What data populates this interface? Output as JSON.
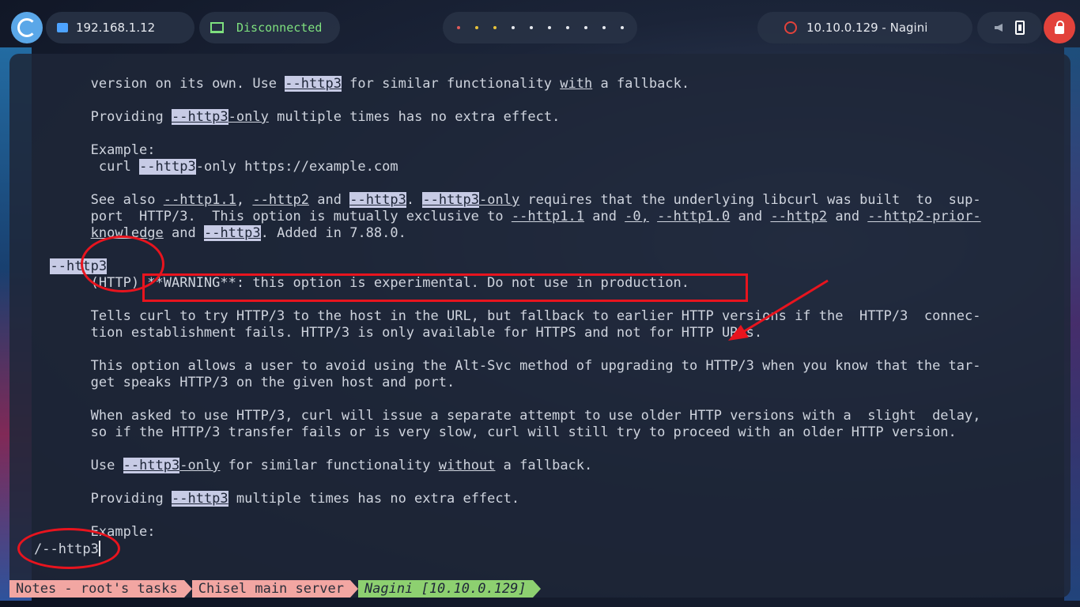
{
  "topbar": {
    "ip": "192.168.1.12",
    "vpn_status": "Disconnected",
    "target": "10.10.0.129 - Nagini",
    "workspace_count": 10,
    "colors": {
      "accent": "#5aa7e8",
      "vpn": "#7ee07e",
      "danger": "#e2423b"
    }
  },
  "terminal": {
    "lines": [
      {
        "segments": [
          {
            "t": "       version on its own. Use "
          },
          {
            "t": "--http3",
            "hl": true,
            "ul": true
          },
          {
            "t": " for similar functionality "
          },
          {
            "t": "with",
            "ul": true
          },
          {
            "t": " a fallback."
          }
        ]
      },
      {
        "segments": [
          {
            "t": ""
          }
        ]
      },
      {
        "segments": [
          {
            "t": "       Providing "
          },
          {
            "t": "--http3",
            "hl": true,
            "ul": true
          },
          {
            "t": "-only",
            "ul": true
          },
          {
            "t": " multiple times has no extra effect."
          }
        ]
      },
      {
        "segments": [
          {
            "t": ""
          }
        ]
      },
      {
        "segments": [
          {
            "t": "       Example:"
          }
        ]
      },
      {
        "segments": [
          {
            "t": "        curl "
          },
          {
            "t": "--http3",
            "hl": true
          },
          {
            "t": "-only https://example.com"
          }
        ]
      },
      {
        "segments": [
          {
            "t": ""
          }
        ]
      },
      {
        "segments": [
          {
            "t": "       See also "
          },
          {
            "t": "--http1.1",
            "ul": true
          },
          {
            "t": ", "
          },
          {
            "t": "--http2",
            "ul": true
          },
          {
            "t": " and "
          },
          {
            "t": "--http3",
            "hl": true,
            "ul": true
          },
          {
            "t": ". "
          },
          {
            "t": "--http3",
            "hl": true,
            "ul": true
          },
          {
            "t": "-only",
            "ul": true
          },
          {
            "t": " requires that the underlying libcurl was built  to  sup-"
          }
        ]
      },
      {
        "segments": [
          {
            "t": "       port  HTTP/3.  This option is mutually exclusive to "
          },
          {
            "t": "--http1.1",
            "ul": true
          },
          {
            "t": " and "
          },
          {
            "t": "-0,",
            "ul": true
          },
          {
            "t": " "
          },
          {
            "t": "--http1.0",
            "ul": true
          },
          {
            "t": " and "
          },
          {
            "t": "--http2",
            "ul": true
          },
          {
            "t": " and "
          },
          {
            "t": "--http2-prior-",
            "ul": true
          }
        ]
      },
      {
        "segments": [
          {
            "t": "       "
          },
          {
            "t": "knowledge",
            "ul": true
          },
          {
            "t": " and "
          },
          {
            "t": "--http3",
            "hl": true,
            "ul": true
          },
          {
            "t": ". Added in 7.88.0."
          }
        ]
      },
      {
        "segments": [
          {
            "t": ""
          }
        ]
      },
      {
        "segments": [
          {
            "t": "  "
          },
          {
            "t": "--http3",
            "hl": true
          }
        ]
      },
      {
        "segments": [
          {
            "t": "       (HTTP) **WARNING**: this option is experimental. Do not use in production."
          }
        ]
      },
      {
        "segments": [
          {
            "t": ""
          }
        ]
      },
      {
        "segments": [
          {
            "t": "       Tells curl to try HTTP/3 to the host in the URL, but fallback to earlier HTTP versions if the  HTTP/3  connec-"
          }
        ]
      },
      {
        "segments": [
          {
            "t": "       tion establishment fails. HTTP/3 is only available for HTTPS and not for HTTP URLs."
          }
        ]
      },
      {
        "segments": [
          {
            "t": ""
          }
        ]
      },
      {
        "segments": [
          {
            "t": "       This option allows a user to avoid using the Alt-Svc method of upgrading to HTTP/3 when you know that the tar-"
          }
        ]
      },
      {
        "segments": [
          {
            "t": "       get speaks HTTP/3 on the given host and port."
          }
        ]
      },
      {
        "segments": [
          {
            "t": ""
          }
        ]
      },
      {
        "segments": [
          {
            "t": "       When asked to use HTTP/3, curl will issue a separate attempt to use older HTTP versions with a  slight  delay,"
          }
        ]
      },
      {
        "segments": [
          {
            "t": "       so if the HTTP/3 transfer fails or is very slow, curl will still try to proceed with an older HTTP version."
          }
        ]
      },
      {
        "segments": [
          {
            "t": ""
          }
        ]
      },
      {
        "segments": [
          {
            "t": "       Use "
          },
          {
            "t": "--http3",
            "hl": true,
            "ul": true
          },
          {
            "t": "-only",
            "ul": true
          },
          {
            "t": " for similar functionality "
          },
          {
            "t": "without",
            "ul": true
          },
          {
            "t": " a fallback."
          }
        ]
      },
      {
        "segments": [
          {
            "t": ""
          }
        ]
      },
      {
        "segments": [
          {
            "t": "       Providing "
          },
          {
            "t": "--http3",
            "hl": true,
            "ul": true
          },
          {
            "t": " multiple times has no extra effect."
          }
        ]
      },
      {
        "segments": [
          {
            "t": ""
          }
        ]
      },
      {
        "segments": [
          {
            "t": "       Example:"
          }
        ]
      }
    ],
    "search_prompt": "/--http3"
  },
  "statusbar": {
    "segments": [
      {
        "label": "Notes - root's tasks",
        "active": false
      },
      {
        "label": "Chisel main server",
        "active": false
      },
      {
        "label": "Nagini [10.10.0.129]",
        "active": true
      }
    ]
  }
}
